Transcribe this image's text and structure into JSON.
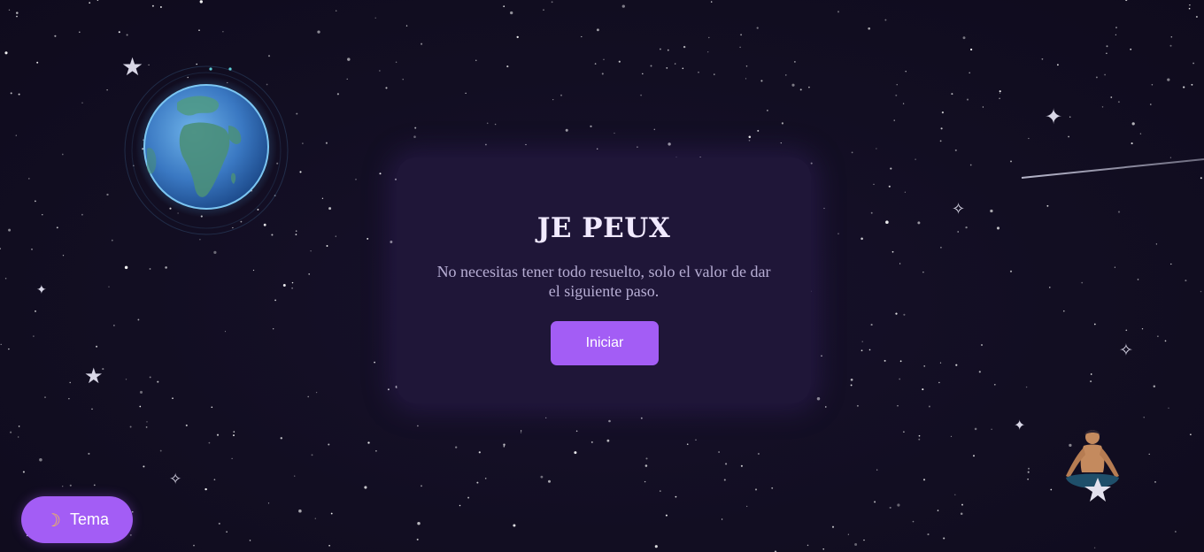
{
  "card": {
    "title": "JE PEUX",
    "message": "No necesitas tener todo resuelto, solo el valor de dar el siguiente paso.",
    "start_label": "Iniciar"
  },
  "theme_toggle": {
    "label": "Tema",
    "icon": "crescent-moon-icon"
  },
  "decorations": {
    "earth": "earth-globe-icon",
    "meditator": "meditating-person-icon",
    "meteor": "shooting-star-icon"
  },
  "colors": {
    "background": "#120e22",
    "card": "#1f1638",
    "accent": "#a35df5",
    "title": "#f1eaff",
    "message": "#b7aed4"
  }
}
